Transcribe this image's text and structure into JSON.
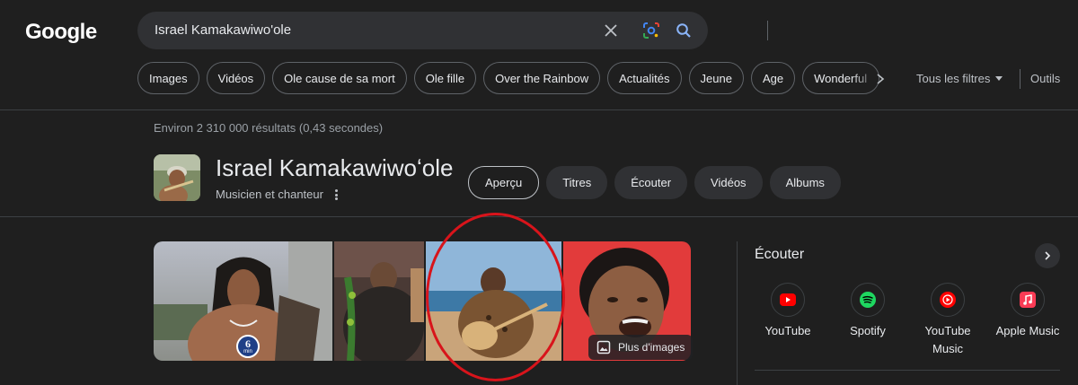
{
  "brand": {
    "logo": "Google"
  },
  "search": {
    "query": "Israel Kamakawiwo'ole",
    "icons": [
      "close-icon",
      "google-lens-icon",
      "search-icon"
    ]
  },
  "chips": [
    "Images",
    "Vidéos",
    "Ole cause de sa mort",
    "Ole fille",
    "Over the Rainbow",
    "Actualités",
    "Jeune",
    "Age",
    "Wonderful"
  ],
  "toolbar": {
    "filters_label": "Tous les filtres",
    "tools_label": "Outils"
  },
  "results": {
    "stats": "Environ 2 310 000 résultats (0,43 secondes)"
  },
  "entity": {
    "name": "Israel Kamakawiwoʻole",
    "subtitle": "Musicien et chanteur",
    "tabs": [
      "Aperçu",
      "Titres",
      "Écouter",
      "Vidéos",
      "Albums"
    ],
    "active_tab": "Aperçu"
  },
  "images": {
    "more_label": "Plus d'images",
    "badge": {
      "number": "6",
      "unit": "min"
    }
  },
  "listen": {
    "title": "Écouter",
    "services": [
      {
        "name": "YouTube",
        "icon": "youtube-icon",
        "color": "#ff0000"
      },
      {
        "name": "Spotify",
        "icon": "spotify-icon",
        "color": "#1ed760"
      },
      {
        "name": "YouTube Music",
        "icon": "youtube-music-icon",
        "color": "#ff0000"
      },
      {
        "name": "Apple Music",
        "icon": "apple-music-icon",
        "color": "#fa3b55"
      }
    ]
  },
  "colors": {
    "background": "#1f1f1f",
    "surface": "#303134",
    "text": "#e8eaed",
    "muted": "#9aa0a6",
    "annotation_circle": "#d8141b"
  }
}
